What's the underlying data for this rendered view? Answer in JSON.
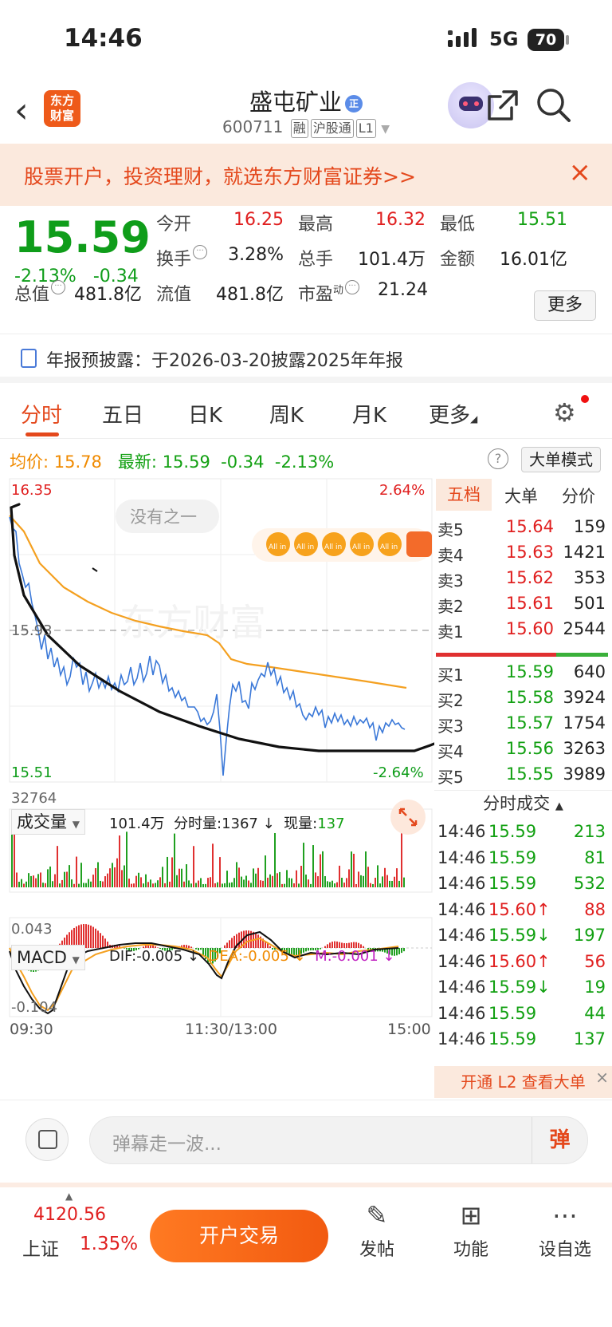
{
  "status_bar": {
    "time": "14:46",
    "network": "5G",
    "battery": "70"
  },
  "header": {
    "back_icon": "chevron-left-icon",
    "logo": "东方\n财富",
    "stock_name": "盛屯矿业",
    "badge": "正",
    "code": "600711",
    "tags": [
      "融",
      "沪股通",
      "L1"
    ],
    "icons": [
      "robot-avatar-icon",
      "share-icon",
      "search-icon"
    ]
  },
  "banner": {
    "text": "股票开户，投资理财，就选东方财富证券>>",
    "close": "×"
  },
  "quote": {
    "price": "15.59",
    "change_pct": "-2.13%",
    "change": "-0.34",
    "open_label": "今开",
    "open": "16.25",
    "high_label": "最高",
    "high": "16.32",
    "low_label": "最低",
    "low": "15.51",
    "turnover_label": "换手",
    "turnover": "3.28%",
    "volume_label": "总手",
    "volume": "101.4万",
    "amount_label": "金额",
    "amount": "16.01亿",
    "mcap_label": "总值",
    "mcap": "481.8亿",
    "float_label": "流值",
    "float": "481.8亿",
    "pe_label": "市盈",
    "pe_sup": "动",
    "pe": "21.24",
    "more": "更多"
  },
  "notice": {
    "text": "年报预披露：于2026-03-20披露2025年年报"
  },
  "tabs": {
    "items": [
      "分时",
      "五日",
      "日K",
      "周K",
      "月K",
      "更多"
    ],
    "active": 0
  },
  "avg_line": {
    "avg_label": "均价:",
    "avg": "15.78",
    "last_label": "最新:",
    "last": "15.59",
    "chg": "-0.34",
    "pct": "-2.13%",
    "mode_btn": "大单模式"
  },
  "chart_labels": {
    "max_price": "16.35",
    "max_pct": "2.64%",
    "min_price": "15.51",
    "min_pct": "-2.64%",
    "prev_close": "15.93",
    "bubble": "没有之一",
    "watermark": "东方财富",
    "allin": "All in",
    "vol_select": "成交量",
    "vol_total": "101.4万",
    "vol_minute_label": "分时量:",
    "vol_minute": "1367",
    "vol_now_label": "现量:",
    "vol_now": "137",
    "vol_max": "32764",
    "macd_select": "MACD",
    "dif": "DIF:-0.005 ↓",
    "dea": "DEA:-0.005 ↓",
    "m": "M:-0.001 ↓",
    "macd_max": "0.043",
    "macd_min": "-0.104",
    "t_start": "09:30",
    "t_mid": "11:30/13:00",
    "t_end": "15:00"
  },
  "book": {
    "tabs": [
      "五档",
      "大单",
      "分价"
    ],
    "sells": [
      {
        "label": "卖5",
        "price": "15.64",
        "vol": "159"
      },
      {
        "label": "卖4",
        "price": "15.63",
        "vol": "1421"
      },
      {
        "label": "卖3",
        "price": "15.62",
        "vol": "353"
      },
      {
        "label": "卖2",
        "price": "15.61",
        "vol": "501"
      },
      {
        "label": "卖1",
        "price": "15.60",
        "vol": "2544"
      }
    ],
    "buys": [
      {
        "label": "买1",
        "price": "15.59",
        "vol": "640"
      },
      {
        "label": "买2",
        "price": "15.58",
        "vol": "3924"
      },
      {
        "label": "买3",
        "price": "15.57",
        "vol": "1754"
      },
      {
        "label": "买4",
        "price": "15.56",
        "vol": "3263"
      },
      {
        "label": "买5",
        "price": "15.55",
        "vol": "3989"
      }
    ],
    "trades_title": "分时成交",
    "trades": [
      {
        "time": "14:46",
        "price": "15.59",
        "vol": "213",
        "color": "green"
      },
      {
        "time": "14:46",
        "price": "15.59",
        "vol": "81",
        "color": "green"
      },
      {
        "time": "14:46",
        "price": "15.59",
        "vol": "532",
        "color": "green"
      },
      {
        "time": "14:46",
        "price": "15.60↑",
        "vol": "88",
        "color": "red"
      },
      {
        "time": "14:46",
        "price": "15.59↓",
        "vol": "197",
        "color": "green"
      },
      {
        "time": "14:46",
        "price": "15.60↑",
        "vol": "56",
        "color": "red"
      },
      {
        "time": "14:46",
        "price": "15.59↓",
        "vol": "19",
        "color": "green"
      },
      {
        "time": "14:46",
        "price": "15.59",
        "vol": "44",
        "color": "green"
      },
      {
        "time": "14:46",
        "price": "15.59",
        "vol": "137",
        "color": "green"
      }
    ],
    "l2_text": "开通 L2 查看大单"
  },
  "comment": {
    "placeholder": "弹幕走一波...",
    "danmu_btn": "弹"
  },
  "bottom": {
    "index_value": "4120.56",
    "index_name": "上证",
    "index_pct": "1.35%",
    "trade_btn": "开户交易",
    "nav": [
      {
        "label": "发帖",
        "icon": "edit-icon"
      },
      {
        "label": "功能",
        "icon": "grid-icon"
      },
      {
        "label": "设自选",
        "icon": "more-dots-icon"
      }
    ]
  }
}
